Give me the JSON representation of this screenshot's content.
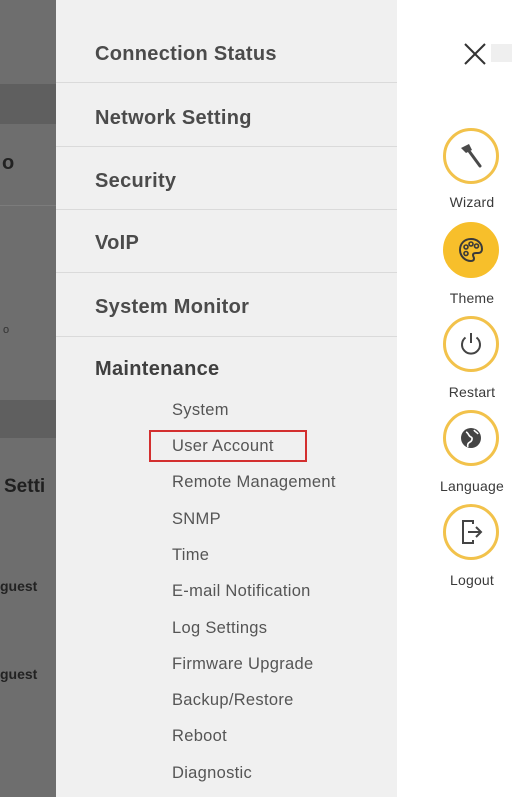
{
  "background": {
    "fragments": [
      "o",
      "o",
      "Setti",
      "guest",
      "guest"
    ]
  },
  "menu": {
    "items": [
      {
        "label": "Connection Status"
      },
      {
        "label": "Network Setting"
      },
      {
        "label": "Security"
      },
      {
        "label": "VoIP"
      },
      {
        "label": "System Monitor"
      },
      {
        "label": "Maintenance"
      }
    ],
    "maintenance_submenu": [
      {
        "label": "System"
      },
      {
        "label": "User Account",
        "highlighted": true
      },
      {
        "label": "Remote Management"
      },
      {
        "label": "SNMP"
      },
      {
        "label": "Time"
      },
      {
        "label": "E-mail Notification"
      },
      {
        "label": "Log Settings"
      },
      {
        "label": "Firmware Upgrade"
      },
      {
        "label": "Backup/Restore"
      },
      {
        "label": "Reboot"
      },
      {
        "label": "Diagnostic"
      }
    ]
  },
  "quick_actions": [
    {
      "label": "Wizard",
      "icon": "wand-icon"
    },
    {
      "label": "Theme",
      "icon": "palette-icon",
      "active": true
    },
    {
      "label": "Restart",
      "icon": "power-icon"
    },
    {
      "label": "Language",
      "icon": "globe-icon"
    },
    {
      "label": "Logout",
      "icon": "logout-icon"
    }
  ],
  "colors": {
    "accent": "#f7bf2b",
    "highlight_border": "#d32f2f",
    "menu_bg": "#f0f0f0",
    "overlay": "#6e6e6e"
  }
}
